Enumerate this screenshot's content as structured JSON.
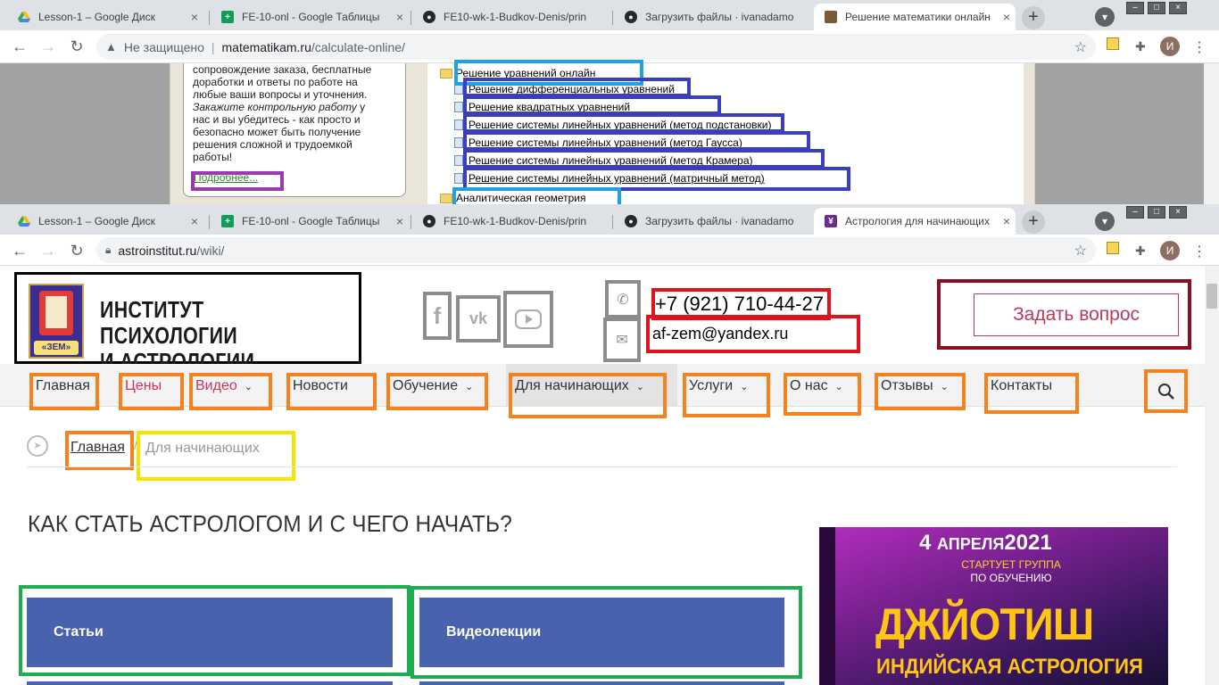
{
  "window1": {
    "tabs": [
      {
        "label": "Lesson-1 – Google Диск",
        "icon": "google-drive-icon"
      },
      {
        "label": "FE-10-onl - Google Таблицы",
        "icon": "google-sheets-icon"
      },
      {
        "label": "FE10-wk-1-Budkov-Denis/prin",
        "icon": "github-icon"
      },
      {
        "label": "Загрузить файлы · ivanadamo",
        "icon": "github-icon"
      },
      {
        "label": "Решение математики онлайн",
        "icon": "site-favicon-icon"
      }
    ],
    "address": {
      "security": "Не защищено",
      "domain": "matematikam.ru",
      "path": "/calculate-online/"
    },
    "avatar_letter": "И",
    "left_panel": {
      "lines": [
        "сопровождение заказа, бесплатные",
        "доработки и ответы по работе на",
        "любые ваши вопросы и уточнения."
      ],
      "italic_text": "Закажите контрольную работу",
      "after_italic": " у",
      "lines2": [
        "нас и вы убедитесь - как просто и",
        "безопасно может быть получение",
        "решения сложной и трудоемкой",
        "работы!"
      ],
      "more_link": "Подробнее..."
    },
    "tree": {
      "folder1": "Решение уравнений онлайн",
      "items": [
        "Решение дифференциальных уравнений",
        "Решение квадратных уравнений",
        "Решение системы линейных уравнений (метод подстановки)",
        "Решение системы линейных уравнений (метод Гаусса)",
        "Решение системы линейных уравнений (метод Крамера)",
        "Решение системы линейных уравнений (матричный метод)"
      ],
      "folder2": "Аналитическая геометрия"
    }
  },
  "window2": {
    "tabs": [
      {
        "label": "Lesson-1 – Google Диск",
        "icon": "google-drive-icon"
      },
      {
        "label": "FE-10-onl - Google Таблицы",
        "icon": "google-sheets-icon"
      },
      {
        "label": "FE10-wk-1-Budkov-Denis/prin",
        "icon": "github-icon"
      },
      {
        "label": "Загрузить файлы · ivanadamo",
        "icon": "github-icon"
      },
      {
        "label": "Астрология для начинающих",
        "icon": "astro-favicon-icon"
      }
    ],
    "address": {
      "domain": "astroinstitut.ru",
      "path": "/wiki/"
    },
    "avatar_letter": "И",
    "site": {
      "logo_caption": "«ЗЕМ»",
      "name_line1": "ИНСТИТУТ ПСИХОЛОГИИ",
      "name_line2": "И АСТРОЛОГИИ",
      "phone": "+7 (921) 710-44-27",
      "email": "af-zem@yandex.ru",
      "ask_button": "Задать вопрос",
      "nav": [
        {
          "label": "Главная"
        },
        {
          "label": "Цены"
        },
        {
          "label": "Видео"
        },
        {
          "label": "Новости"
        },
        {
          "label": "Обучение"
        },
        {
          "label": "Для начинающих"
        },
        {
          "label": "Услуги"
        },
        {
          "label": "О нас"
        },
        {
          "label": "Отзывы"
        },
        {
          "label": "Контакты"
        }
      ],
      "breadcrumb": {
        "home": "Главная",
        "current": "Для начинающих"
      },
      "title": "КАК СТАТЬ АСТРОЛОГОМ И С ЧЕГО НАЧАТЬ?",
      "cards": [
        "Статьи",
        "Видеолекции"
      ],
      "promo": {
        "day": "4",
        "month": "АПРЕЛЯ",
        "year": "2021",
        "starts": "СТАРТУЕТ ГРУППА",
        "group": "ПО ОБУЧЕНИЮ",
        "headline": "ДЖЙОТИШ",
        "sub": "ИНДИЙСКАЯ АСТРОЛОГИЯ"
      }
    }
  },
  "colors": {
    "orange_box": "#f5821f",
    "red_box": "#e3111c",
    "green_box": "#1fae4f",
    "yellow_box": "#f4e400",
    "blue_box": "#3a3fbf",
    "cyan_box": "#1fa3e0",
    "purple_box": "#9b3ab0",
    "maroon_box": "#8b0f23",
    "card_blue": "#4962ad",
    "ask_red": "#b73c59"
  }
}
